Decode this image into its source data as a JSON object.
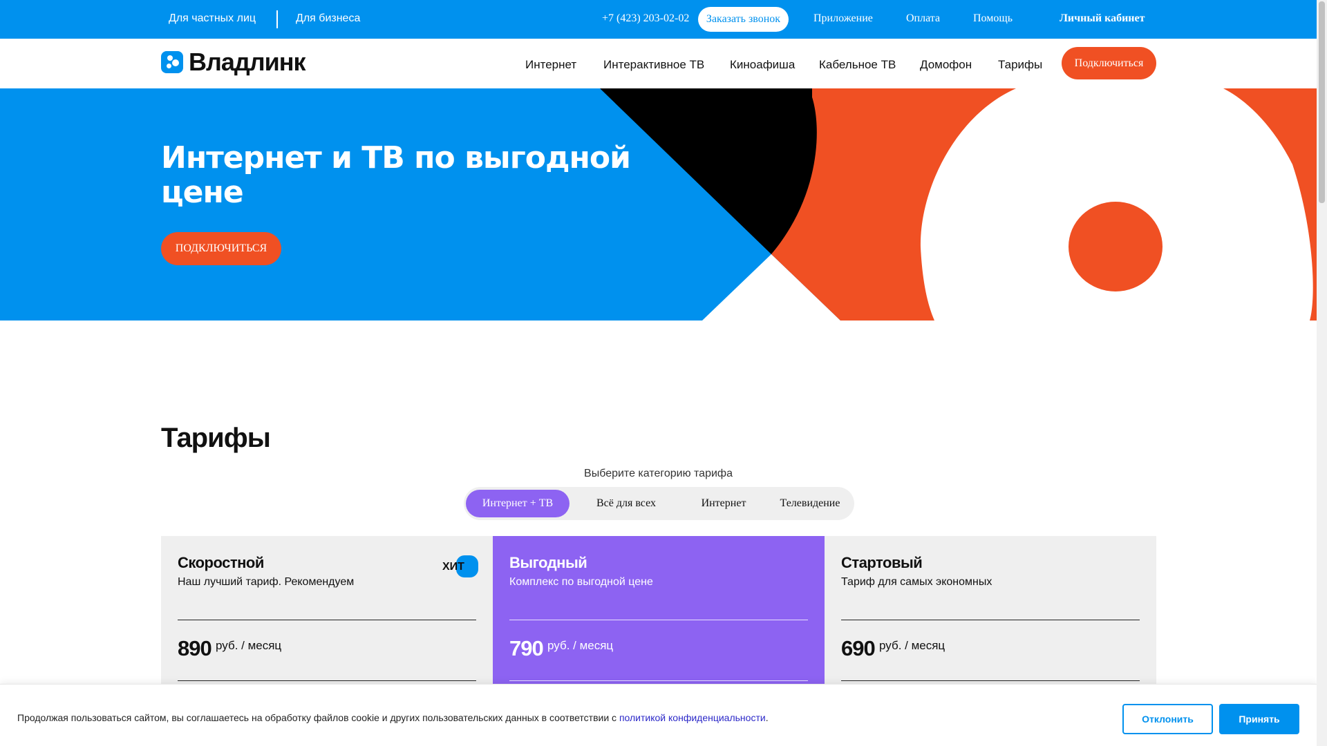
{
  "topbar": {
    "private": "Для частных лиц",
    "business": "Для бизнеса",
    "phone": "+7 (423) 203-02-02",
    "call_button": "Заказать звонок",
    "app": "Приложение",
    "payment": "Оплата",
    "help": "Помощь",
    "cabinet": "Личный кабинет"
  },
  "nav": {
    "logo": "Владлинк",
    "items": [
      "Интернет",
      "Интерактивное ТВ",
      "Киноафиша",
      "Кабельное ТВ",
      "Домофон",
      "Тарифы"
    ],
    "connect": "Подключиться"
  },
  "hero": {
    "title": "Интернет и ТВ по выгодной цене",
    "button": "ПОДКЛЮЧИТЬСЯ"
  },
  "tariffs": {
    "title": "Тарифы",
    "subtitle": "Выберите категорию тарифа",
    "tabs": [
      "Интернет + ТВ",
      "Всё для всех",
      "Интернет",
      "Телевидение"
    ],
    "active_tab": "Интернет + ТВ",
    "cards": [
      {
        "name": "Скоростной",
        "desc": "Наш лучший тариф. Рекомендуем",
        "price": "890",
        "unit": "руб. / месяц",
        "badge": "ХИТ"
      },
      {
        "name": "Выгодный",
        "desc": "Комплекс по выгодной цене",
        "price": "790",
        "unit": "руб. / месяц"
      },
      {
        "name": "Стартовый",
        "desc": "Тариф для самых экономных",
        "price": "690",
        "unit": "руб. / месяц"
      }
    ]
  },
  "cookie": {
    "text": "Продолжая пользоваться сайтом, вы соглашаетесь на обработку файлов cookie и других пользовательских данных в соответствии с",
    "link": "политикой конфиденциальности",
    "link_suffix": ".",
    "decline": "Отклонить",
    "accept": "Принять"
  },
  "colors": {
    "brand_blue": "#0091ee",
    "accent_orange": "#f05023",
    "accent_purple": "#8d63f2"
  }
}
